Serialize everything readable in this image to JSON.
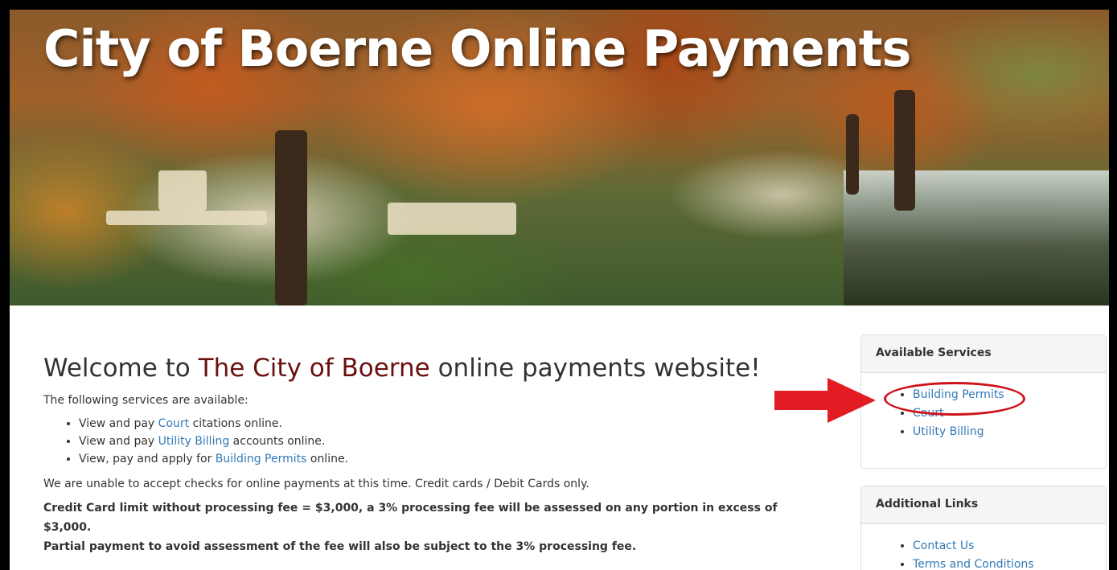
{
  "hero": {
    "title": "City of Boerne Online Payments"
  },
  "welcome": {
    "prefix": "Welcome to ",
    "brand": "The City of Boerne",
    "suffix": " online payments website!"
  },
  "intro": "The following services are available:",
  "services": [
    {
      "pre": "View and pay ",
      "link": "Court",
      "post": " citations online."
    },
    {
      "pre": "View and pay ",
      "link": "Utility Billing",
      "post": " accounts online."
    },
    {
      "pre": "View, pay and apply for ",
      "link": "Building Permits",
      "post": " online."
    }
  ],
  "checks_notice": "We are unable to accept checks for online payments at this time. Credit cards / Debit Cards only.",
  "fee_notice": [
    "Credit Card limit without processing fee = $3,000, a 3% processing fee will be assessed on any portion in excess of $3,000.",
    "Partial payment to avoid assessment of the fee will also be subject to the 3% processing fee."
  ],
  "available_services": {
    "title": "Available Services",
    "items": [
      "Building Permits",
      "Court",
      "Utility Billing"
    ]
  },
  "additional_links": {
    "title": "Additional Links",
    "items": [
      "Contact Us",
      "Terms and Conditions"
    ]
  },
  "colors": {
    "brand": "#6b1010",
    "link": "#337ab7",
    "annotation": "#d0121b"
  }
}
